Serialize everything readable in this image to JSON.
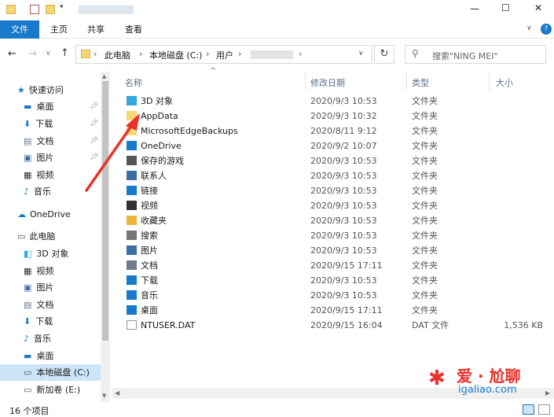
{
  "titlebar": {
    "min": "—",
    "max": "☐",
    "close": "✕"
  },
  "ribbon": {
    "tabs": [
      "文件",
      "主页",
      "共享",
      "查看"
    ]
  },
  "address": {
    "crumbs": [
      "此电脑",
      "本地磁盘 (C:)",
      "用户"
    ],
    "search_placeholder": "搜索\"NING MEI\""
  },
  "columns": {
    "name": "名称",
    "date": "修改日期",
    "type": "类型",
    "size": "大小"
  },
  "nav": {
    "quick_access": "快速访问",
    "quick_items": [
      "桌面",
      "下载",
      "文档",
      "图片",
      "视频",
      "音乐"
    ],
    "onedrive": "OneDrive",
    "this_pc": "此电脑",
    "pc_items": [
      "3D 对象",
      "视频",
      "图片",
      "文档",
      "下载",
      "音乐",
      "桌面",
      "本地磁盘 (C:)",
      "新加卷 (E:)"
    ]
  },
  "files": [
    {
      "name": "3D 对象",
      "date": "2020/9/3 10:53",
      "type": "文件夹",
      "size": ""
    },
    {
      "name": "AppData",
      "date": "2020/9/3 10:32",
      "type": "文件夹",
      "size": ""
    },
    {
      "name": "MicrosoftEdgeBackups",
      "date": "2020/8/11 9:12",
      "type": "文件夹",
      "size": ""
    },
    {
      "name": "OneDrive",
      "date": "2020/9/2 10:07",
      "type": "文件夹",
      "size": ""
    },
    {
      "name": "保存的游戏",
      "date": "2020/9/3 10:53",
      "type": "文件夹",
      "size": ""
    },
    {
      "name": "联系人",
      "date": "2020/9/3 10:53",
      "type": "文件夹",
      "size": ""
    },
    {
      "name": "链接",
      "date": "2020/9/3 10:53",
      "type": "文件夹",
      "size": ""
    },
    {
      "name": "视频",
      "date": "2020/9/3 10:53",
      "type": "文件夹",
      "size": ""
    },
    {
      "name": "收藏夹",
      "date": "2020/9/3 10:53",
      "type": "文件夹",
      "size": ""
    },
    {
      "name": "搜索",
      "date": "2020/9/3 10:53",
      "type": "文件夹",
      "size": ""
    },
    {
      "name": "图片",
      "date": "2020/9/3 10:53",
      "type": "文件夹",
      "size": ""
    },
    {
      "name": "文档",
      "date": "2020/9/15 17:11",
      "type": "文件夹",
      "size": ""
    },
    {
      "name": "下载",
      "date": "2020/9/3 10:53",
      "type": "文件夹",
      "size": ""
    },
    {
      "name": "音乐",
      "date": "2020/9/3 10:53",
      "type": "文件夹",
      "size": ""
    },
    {
      "name": "桌面",
      "date": "2020/9/15 17:11",
      "type": "文件夹",
      "size": ""
    },
    {
      "name": "NTUSER.DAT",
      "date": "2020/9/15 16:04",
      "type": "DAT 文件",
      "size": "1,536 KB"
    }
  ],
  "status": {
    "count": "16 个项目"
  },
  "watermark": {
    "brand": "爱 · 尬聊",
    "url": "igaliao.com"
  },
  "colors": {
    "accent": "#1979ca",
    "arrow": "#e8322b",
    "folder": "#f5d775"
  }
}
